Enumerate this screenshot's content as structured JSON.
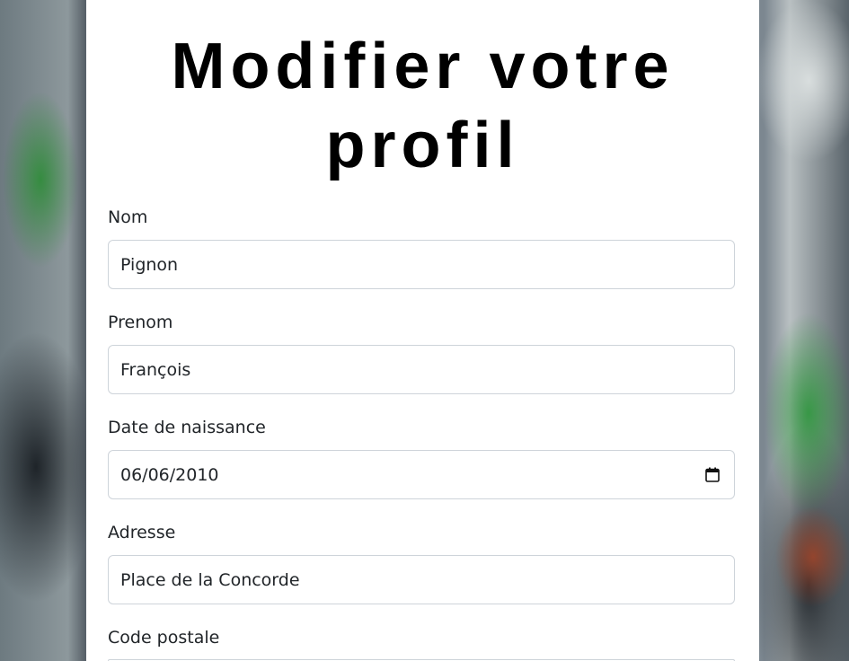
{
  "page": {
    "title": "Modifier votre profil"
  },
  "form": {
    "fields": [
      {
        "label": "Nom",
        "value": "Pignon",
        "type": "text"
      },
      {
        "label": "Prenom",
        "value": "François",
        "type": "text"
      },
      {
        "label": "Date de naissance",
        "value": "06/06/2010",
        "type": "date"
      },
      {
        "label": "Adresse",
        "value": "Place de la Concorde",
        "type": "text"
      },
      {
        "label": "Code postale",
        "value": "",
        "type": "text"
      }
    ]
  },
  "icons": {
    "date": "calendar-icon"
  },
  "colors": {
    "card_background": "#ffffff",
    "input_border": "#ced4da",
    "text": "#212529",
    "title": "#000000"
  }
}
